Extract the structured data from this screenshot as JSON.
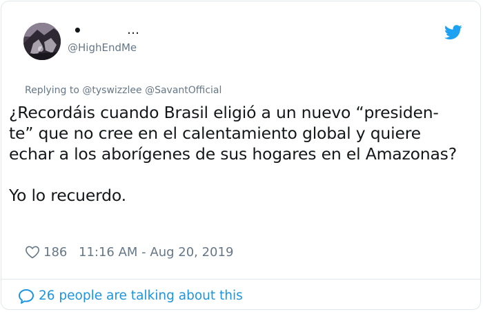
{
  "author": {
    "display_name_dot": "•",
    "display_name_ellipsis": "…",
    "handle": "@HighEndMe",
    "avatar_icon": "profile-photo"
  },
  "header": {
    "logo_icon": "twitter-bird-icon",
    "brand_color": "#1da1f2"
  },
  "reply": {
    "prefix": "Replying to",
    "mentions": [
      "@tyswizzlee",
      "@SavantOfficial"
    ]
  },
  "tweet": {
    "text": "¿Recordáis cuando Brasil eligió a un nuevo “presiden-\nte” que no cree en el calentamiento global y quiere\nechar a los aborígenes de sus hogares en el Amazonas?\n\nYo lo recuerdo."
  },
  "meta": {
    "like_icon": "heart-outline-icon",
    "like_count": "186",
    "timestamp": "11:16 AM - Aug 20, 2019"
  },
  "footer": {
    "talking_icon": "speech-bubble-icon",
    "talking_text": "26 people are talking about this",
    "link_color": "#1b95e0"
  }
}
